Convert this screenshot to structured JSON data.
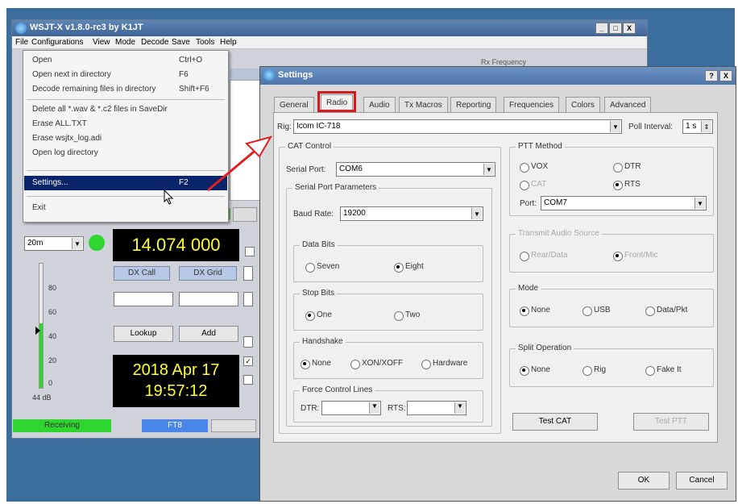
{
  "main_window": {
    "title": "WSJT-X   v1.8.0-rc3   by K1JT",
    "controls": [
      "_",
      "□",
      "X"
    ],
    "menu": [
      "File",
      "Configurations",
      "View",
      "Mode",
      "Decode",
      "Save",
      "Tools",
      "Help"
    ],
    "rx_frequency_label": "Rx Frequency",
    "band": "20m",
    "frequency": "14.074 000",
    "dx_call_label": "DX Call",
    "dx_grid_label": "DX Grid",
    "lookup_label": "Lookup",
    "add_label": "Add",
    "date": "2018 Apr 17",
    "time": "19:57:12",
    "meter_ticks": [
      "80",
      "60",
      "40",
      "20",
      "0"
    ],
    "meter_value": "44 dB",
    "status_receiving": "Receiving",
    "status_mode": "FT8"
  },
  "file_menu": {
    "items": [
      {
        "label": "Open",
        "shortcut": "Ctrl+O"
      },
      {
        "label": "Open next in directory",
        "shortcut": "F6"
      },
      {
        "label": "Decode remaining files in directory",
        "shortcut": "Shift+F6"
      },
      {
        "label": "Delete all *.wav & *.c2 files in SaveDir",
        "shortcut": ""
      },
      {
        "label": "Erase ALL.TXT",
        "shortcut": ""
      },
      {
        "label": "Erase wsjtx_log.adi",
        "shortcut": ""
      },
      {
        "label": "Open log directory",
        "shortcut": ""
      },
      {
        "label": "Settings...",
        "shortcut": "F2"
      },
      {
        "label": "Exit",
        "shortcut": ""
      }
    ]
  },
  "settings": {
    "title": "Settings",
    "title_controls": [
      "?",
      "X"
    ],
    "tabs": [
      "General",
      "Radio",
      "Audio",
      "Tx Macros",
      "Reporting",
      "Frequencies",
      "Colors",
      "Advanced"
    ],
    "active_tab": "Radio",
    "rig_label": "Rig:",
    "rig_value": "Icom IC-718",
    "poll_label": "Poll Interval:",
    "poll_value": "1 s",
    "cat": {
      "title": "CAT Control",
      "serial_port_label": "Serial Port:",
      "serial_port_value": "COM6",
      "params_title": "Serial Port Parameters",
      "baud_label": "Baud Rate:",
      "baud_value": "19200",
      "data_bits_title": "Data Bits",
      "data_bits": [
        "Seven",
        "Eight"
      ],
      "stop_bits_title": "Stop Bits",
      "stop_bits": [
        "One",
        "Two"
      ],
      "handshake_title": "Handshake",
      "handshake": [
        "None",
        "XON/XOFF",
        "Hardware"
      ],
      "force_title": "Force Control Lines",
      "dtr_label": "DTR:",
      "rts_label": "RTS:"
    },
    "ptt": {
      "title": "PTT Method",
      "options": [
        "VOX",
        "DTR",
        "CAT",
        "RTS"
      ],
      "port_label": "Port:",
      "port_value": "COM7"
    },
    "tx_audio": {
      "title": "Transmit Audio Source",
      "options": [
        "Rear/Data",
        "Front/Mic"
      ]
    },
    "mode": {
      "title": "Mode",
      "options": [
        "None",
        "USB",
        "Data/Pkt"
      ]
    },
    "split": {
      "title": "Split Operation",
      "options": [
        "None",
        "Rig",
        "Fake It"
      ]
    },
    "test_cat": "Test CAT",
    "test_ptt": "Test PTT",
    "ok": "OK",
    "cancel": "Cancel"
  },
  "colors": {
    "desktop": "#3c6e9d",
    "highlight": "#d41a1a",
    "display_text": "#ffff2e",
    "receiving_green": "#2fd52f",
    "mode_blue": "#4a86e8"
  }
}
